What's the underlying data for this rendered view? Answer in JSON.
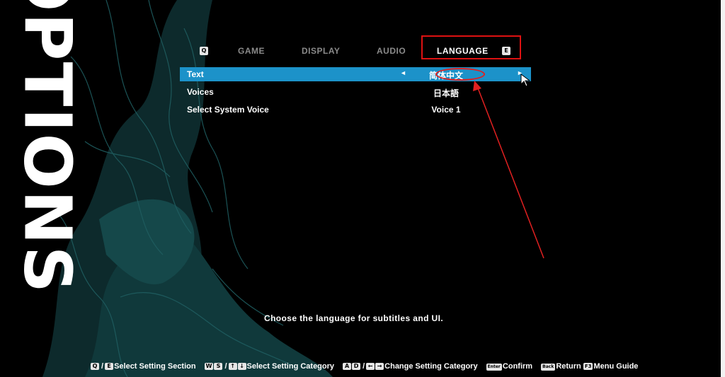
{
  "page": {
    "title": "OPTIONS"
  },
  "tabs": {
    "prev_key": "Q",
    "next_key": "E",
    "items": [
      {
        "label": "GAME",
        "active": false
      },
      {
        "label": "DISPLAY",
        "active": false
      },
      {
        "label": "AUDIO",
        "active": false
      },
      {
        "label": "LANGUAGE",
        "active": true
      }
    ]
  },
  "settings": [
    {
      "label": "Text",
      "value": "简体中文",
      "selected": true
    },
    {
      "label": "Voices",
      "value": "日本語",
      "selected": false
    },
    {
      "label": "Select System Voice",
      "value": "Voice 1",
      "selected": false
    }
  ],
  "arrows": {
    "left": "◄",
    "right": "►"
  },
  "description": "Choose the language for subtitles and UI.",
  "guide": {
    "section_keys": [
      "Q",
      "E"
    ],
    "section_label": "Select Setting Section",
    "category_keys": [
      "W",
      "S",
      "↑",
      "↓"
    ],
    "category_label": "Select Setting Category",
    "change_keys": [
      "A",
      "D",
      "←",
      "→"
    ],
    "change_label": "Change Setting Category",
    "confirm_key": "Enter",
    "confirm_label": "Confirm",
    "return_key": "Back",
    "return_label": "Return",
    "menu_key": "F3",
    "menu_label": "Menu Guide"
  },
  "colors": {
    "accent": "#1c92c9",
    "annotation": "#e02020",
    "background": "#000000",
    "art": "#1f4f52"
  }
}
